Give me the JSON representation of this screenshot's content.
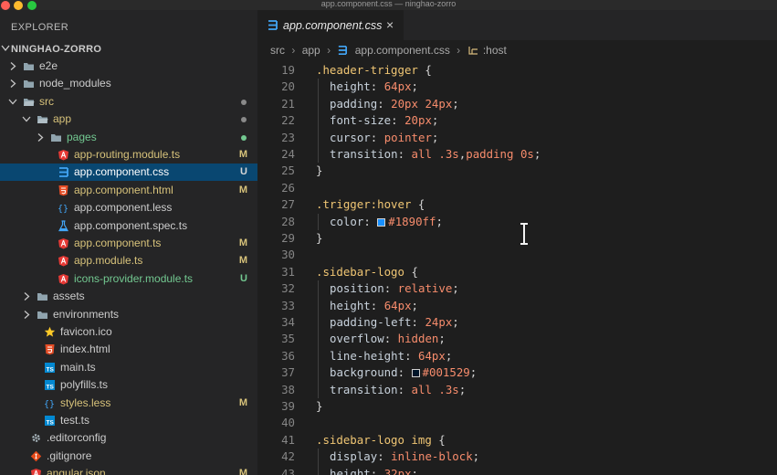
{
  "window": {
    "title": "app.component.css — ninghao-zorro"
  },
  "sidebar": {
    "title": "EXPLORER",
    "project": "NINGHAO-ZORRO",
    "items": [
      {
        "name": "e2e",
        "icon": "folder-icon",
        "kind": "folder",
        "expanded": false,
        "depth": 0,
        "color": "#cccccc"
      },
      {
        "name": "node_modules",
        "icon": "folder-icon",
        "kind": "folder",
        "expanded": false,
        "depth": 0,
        "color": "#cccccc"
      },
      {
        "name": "src",
        "icon": "folder-open-icon",
        "kind": "folder",
        "expanded": true,
        "depth": 0,
        "color": "#d7c27a",
        "dot": "#8a8a8a"
      },
      {
        "name": "app",
        "icon": "folder-open-icon",
        "kind": "folder",
        "expanded": true,
        "depth": 1,
        "color": "#d7c27a",
        "dot": "#8a8a8a"
      },
      {
        "name": "pages",
        "icon": "folder-icon",
        "kind": "folder",
        "expanded": false,
        "depth": 2,
        "color": "#73c991",
        "dot": "#73c991"
      },
      {
        "name": "app-routing.module.ts",
        "icon": "angular-icon",
        "kind": "file",
        "depth": 2,
        "color": "#d7c27a",
        "status": "M",
        "statusColor": "#d7c27a"
      },
      {
        "name": "app.component.css",
        "icon": "css-icon",
        "kind": "file",
        "depth": 2,
        "color": "#ffffff",
        "status": "U",
        "statusColor": "#d6d6d6",
        "selected": true
      },
      {
        "name": "app.component.html",
        "icon": "html-icon",
        "kind": "file",
        "depth": 2,
        "color": "#d7c27a",
        "status": "M",
        "statusColor": "#d7c27a"
      },
      {
        "name": "app.component.less",
        "icon": "less-icon",
        "kind": "file",
        "depth": 2,
        "color": "#cccccc"
      },
      {
        "name": "app.component.spec.ts",
        "icon": "flask-icon",
        "kind": "file",
        "depth": 2,
        "color": "#cccccc"
      },
      {
        "name": "app.component.ts",
        "icon": "angular-icon",
        "kind": "file",
        "depth": 2,
        "color": "#d7c27a",
        "status": "M",
        "statusColor": "#d7c27a"
      },
      {
        "name": "app.module.ts",
        "icon": "angular-icon",
        "kind": "file",
        "depth": 2,
        "color": "#d7c27a",
        "status": "M",
        "statusColor": "#d7c27a"
      },
      {
        "name": "icons-provider.module.ts",
        "icon": "angular-icon",
        "kind": "file",
        "depth": 2,
        "color": "#73c991",
        "status": "U",
        "statusColor": "#73c991"
      },
      {
        "name": "assets",
        "icon": "folder-icon",
        "kind": "folder",
        "expanded": false,
        "depth": 1,
        "color": "#cccccc"
      },
      {
        "name": "environments",
        "icon": "folder-icon",
        "kind": "folder",
        "expanded": false,
        "depth": 1,
        "color": "#cccccc"
      },
      {
        "name": "favicon.ico",
        "icon": "star-icon",
        "kind": "file",
        "depth": 1,
        "color": "#cccccc"
      },
      {
        "name": "index.html",
        "icon": "html-icon",
        "kind": "file",
        "depth": 1,
        "color": "#cccccc"
      },
      {
        "name": "main.ts",
        "icon": "ts-icon",
        "kind": "file",
        "depth": 1,
        "color": "#cccccc"
      },
      {
        "name": "polyfills.ts",
        "icon": "ts-icon",
        "kind": "file",
        "depth": 1,
        "color": "#cccccc"
      },
      {
        "name": "styles.less",
        "icon": "less-icon",
        "kind": "file",
        "depth": 1,
        "color": "#d7c27a",
        "status": "M",
        "statusColor": "#d7c27a"
      },
      {
        "name": "test.ts",
        "icon": "ts-icon",
        "kind": "file",
        "depth": 1,
        "color": "#cccccc"
      },
      {
        "name": ".editorconfig",
        "icon": "gear-icon",
        "kind": "file",
        "depth": 0,
        "color": "#cccccc"
      },
      {
        "name": ".gitignore",
        "icon": "git-icon",
        "kind": "file",
        "depth": 0,
        "color": "#cccccc"
      },
      {
        "name": "angular.json",
        "icon": "angular-icon",
        "kind": "file",
        "depth": 0,
        "color": "#d7c27a",
        "status": "M",
        "statusColor": "#d7c27a"
      }
    ]
  },
  "editor": {
    "tab": {
      "label": "app.component.css",
      "icon": "css-icon",
      "close": "×"
    },
    "breadcrumb": [
      "src",
      "app",
      "app.component.css",
      ":host"
    ],
    "lines": [
      {
        "n": "19",
        "tokens": [
          [
            "sel",
            ".header-trigger"
          ],
          [
            "punct",
            " {"
          ]
        ]
      },
      {
        "n": "20",
        "indent": true,
        "tokens": [
          [
            "prop",
            "height"
          ],
          [
            "punct",
            ": "
          ],
          [
            "num",
            "64px"
          ],
          [
            "punct",
            ";"
          ]
        ]
      },
      {
        "n": "21",
        "indent": true,
        "tokens": [
          [
            "prop",
            "padding"
          ],
          [
            "punct",
            ": "
          ],
          [
            "num",
            "20px 24px"
          ],
          [
            "punct",
            ";"
          ]
        ]
      },
      {
        "n": "22",
        "indent": true,
        "tokens": [
          [
            "prop",
            "font-size"
          ],
          [
            "punct",
            ": "
          ],
          [
            "num",
            "20px"
          ],
          [
            "punct",
            ";"
          ]
        ]
      },
      {
        "n": "23",
        "indent": true,
        "tokens": [
          [
            "prop",
            "cursor"
          ],
          [
            "punct",
            ": "
          ],
          [
            "val",
            "pointer"
          ],
          [
            "punct",
            ";"
          ]
        ]
      },
      {
        "n": "24",
        "indent": true,
        "tokens": [
          [
            "prop",
            "transition"
          ],
          [
            "punct",
            ": "
          ],
          [
            "val",
            "all"
          ],
          [
            "punct",
            " "
          ],
          [
            "num",
            ".3s"
          ],
          [
            "punct",
            ","
          ],
          [
            "val",
            "padding"
          ],
          [
            "punct",
            " "
          ],
          [
            "num",
            "0s"
          ],
          [
            "punct",
            ";"
          ]
        ]
      },
      {
        "n": "25",
        "tokens": [
          [
            "punct",
            "}"
          ]
        ]
      },
      {
        "n": "26",
        "tokens": []
      },
      {
        "n": "27",
        "tokens": [
          [
            "sel",
            ".trigger:hover"
          ],
          [
            "punct",
            " {"
          ]
        ]
      },
      {
        "n": "28",
        "indent": true,
        "tokens": [
          [
            "prop",
            "color"
          ],
          [
            "punct",
            ": "
          ],
          [
            "swatch",
            "#1890ff"
          ],
          [
            "num",
            "#1890ff"
          ],
          [
            "punct",
            ";"
          ]
        ]
      },
      {
        "n": "29",
        "tokens": [
          [
            "punct",
            "}"
          ]
        ]
      },
      {
        "n": "30",
        "tokens": []
      },
      {
        "n": "31",
        "tokens": [
          [
            "sel",
            ".sidebar-logo"
          ],
          [
            "punct",
            " {"
          ]
        ]
      },
      {
        "n": "32",
        "indent": true,
        "tokens": [
          [
            "prop",
            "position"
          ],
          [
            "punct",
            ": "
          ],
          [
            "val",
            "relative"
          ],
          [
            "punct",
            ";"
          ]
        ]
      },
      {
        "n": "33",
        "indent": true,
        "tokens": [
          [
            "prop",
            "height"
          ],
          [
            "punct",
            ": "
          ],
          [
            "num",
            "64px"
          ],
          [
            "punct",
            ";"
          ]
        ]
      },
      {
        "n": "34",
        "indent": true,
        "tokens": [
          [
            "prop",
            "padding-left"
          ],
          [
            "punct",
            ": "
          ],
          [
            "num",
            "24px"
          ],
          [
            "punct",
            ";"
          ]
        ]
      },
      {
        "n": "35",
        "indent": true,
        "tokens": [
          [
            "prop",
            "overflow"
          ],
          [
            "punct",
            ": "
          ],
          [
            "val",
            "hidden"
          ],
          [
            "punct",
            ";"
          ]
        ]
      },
      {
        "n": "36",
        "indent": true,
        "tokens": [
          [
            "prop",
            "line-height"
          ],
          [
            "punct",
            ": "
          ],
          [
            "num",
            "64px"
          ],
          [
            "punct",
            ";"
          ]
        ]
      },
      {
        "n": "37",
        "indent": true,
        "tokens": [
          [
            "prop",
            "background"
          ],
          [
            "punct",
            ": "
          ],
          [
            "swatch",
            "#001529"
          ],
          [
            "num",
            "#001529"
          ],
          [
            "punct",
            ";"
          ]
        ]
      },
      {
        "n": "38",
        "indent": true,
        "tokens": [
          [
            "prop",
            "transition"
          ],
          [
            "punct",
            ": "
          ],
          [
            "val",
            "all"
          ],
          [
            "punct",
            " "
          ],
          [
            "num",
            ".3s"
          ],
          [
            "punct",
            ";"
          ]
        ]
      },
      {
        "n": "39",
        "tokens": [
          [
            "punct",
            "}"
          ]
        ]
      },
      {
        "n": "40",
        "tokens": []
      },
      {
        "n": "41",
        "tokens": [
          [
            "sel",
            ".sidebar-logo img"
          ],
          [
            "punct",
            " {"
          ]
        ]
      },
      {
        "n": "42",
        "indent": true,
        "tokens": [
          [
            "prop",
            "display"
          ],
          [
            "punct",
            ": "
          ],
          [
            "val",
            "inline-block"
          ],
          [
            "punct",
            ";"
          ]
        ]
      },
      {
        "n": "43",
        "indent": true,
        "tokens": [
          [
            "prop",
            "height"
          ],
          [
            "punct",
            ": "
          ],
          [
            "num",
            "32px"
          ],
          [
            "punct",
            ";"
          ]
        ]
      }
    ]
  }
}
